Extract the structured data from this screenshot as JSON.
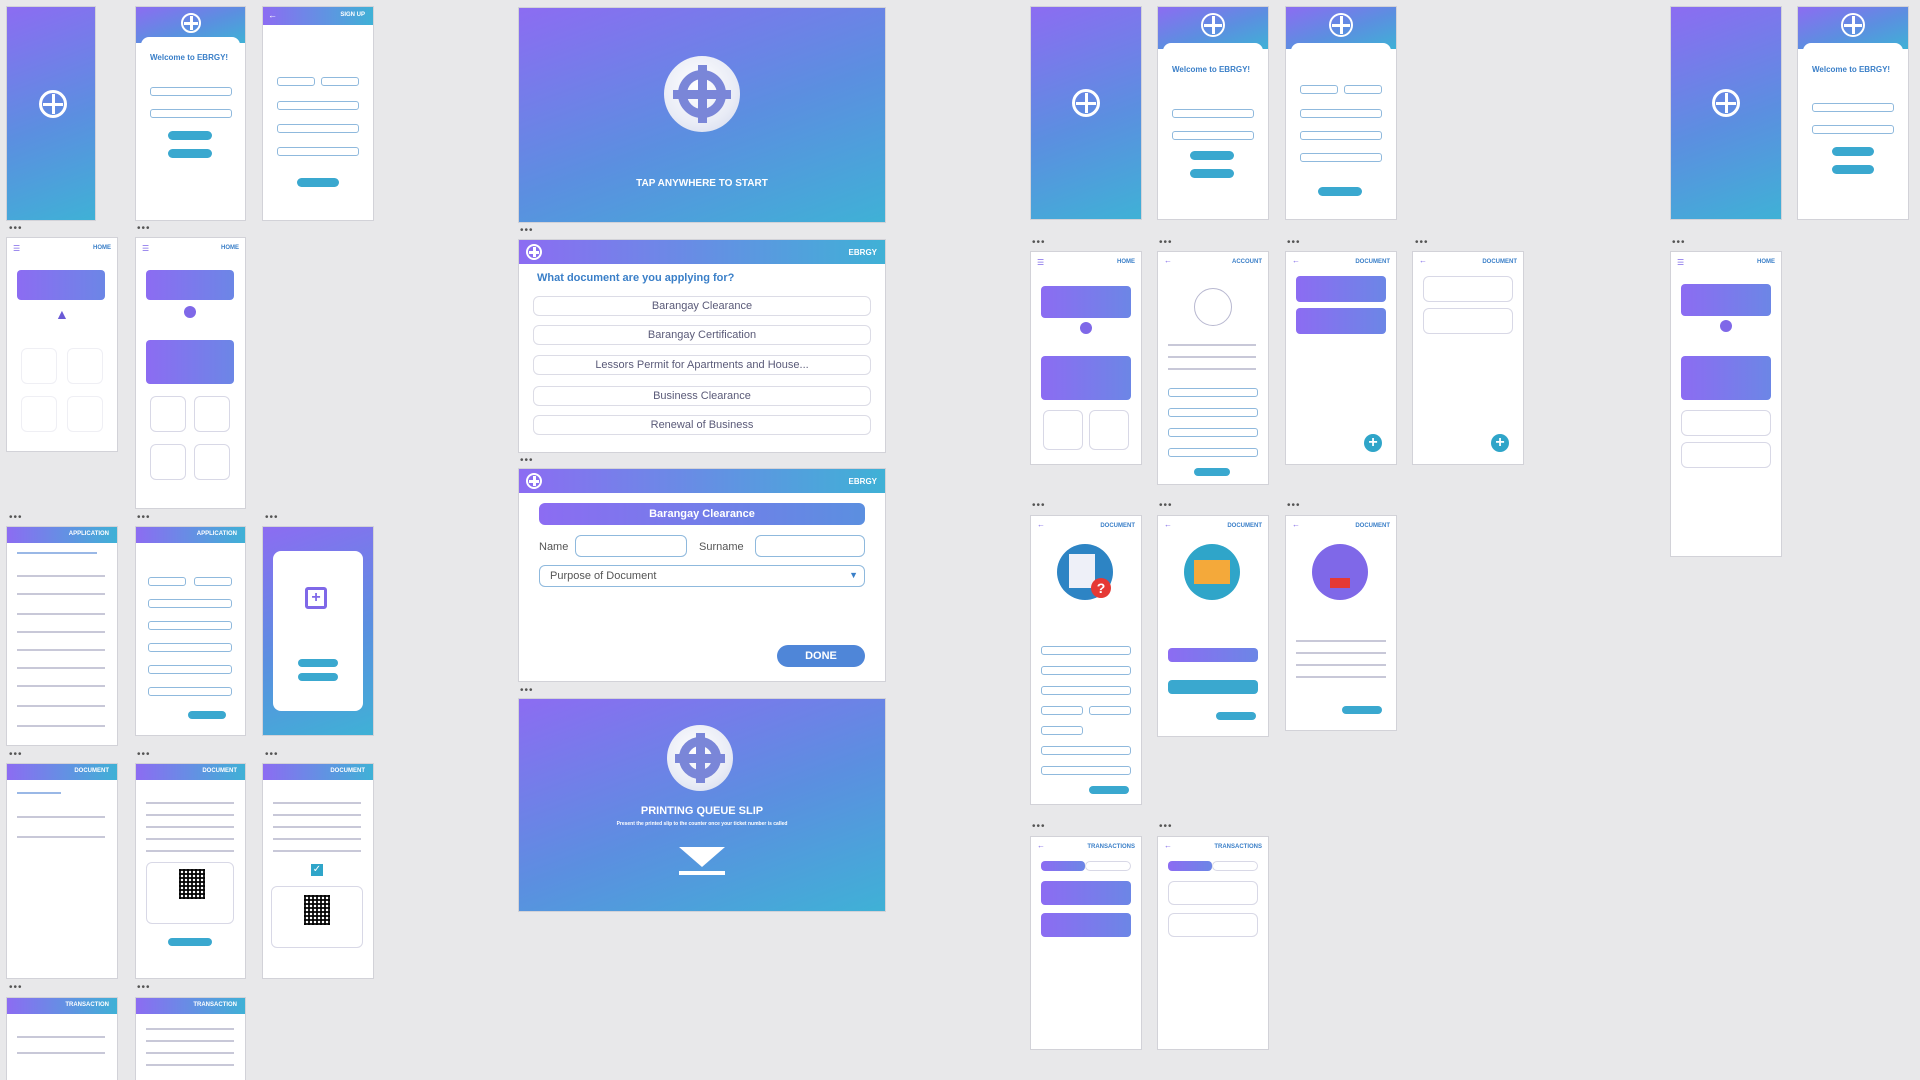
{
  "app": {
    "brand": "EBRGY",
    "tap_to_start": "TAP ANYWHERE TO START",
    "welcome": "Welcome to EBRGY!",
    "sign_up": "SIGN UP",
    "home": "HOME",
    "account": "ACCOUNT",
    "document": "DOCUMENT",
    "transaction": "TRANSACTION",
    "transactions": "TRANSACTIONS",
    "application": "APPLICATION"
  },
  "kiosk_select": {
    "question": "What document are you applying for?",
    "options": [
      "Barangay Clearance",
      "Barangay Certification",
      "Lessors Permit for Apartments and House...",
      "Business Clearance",
      "Renewal of Business"
    ]
  },
  "kiosk_form": {
    "header": "Barangay Clearance",
    "name_label": "Name",
    "surname_label": "Surname",
    "purpose_placeholder": "Purpose of Document",
    "done": "DONE"
  },
  "kiosk_slip": {
    "title": "PRINTING QUEUE SLIP",
    "subtitle": "Present the printed slip to the counter once your ticket number is called"
  },
  "colors": {
    "purple": "#8c6cf2",
    "teal": "#3fb1d6",
    "button": "#2fa5c9"
  }
}
